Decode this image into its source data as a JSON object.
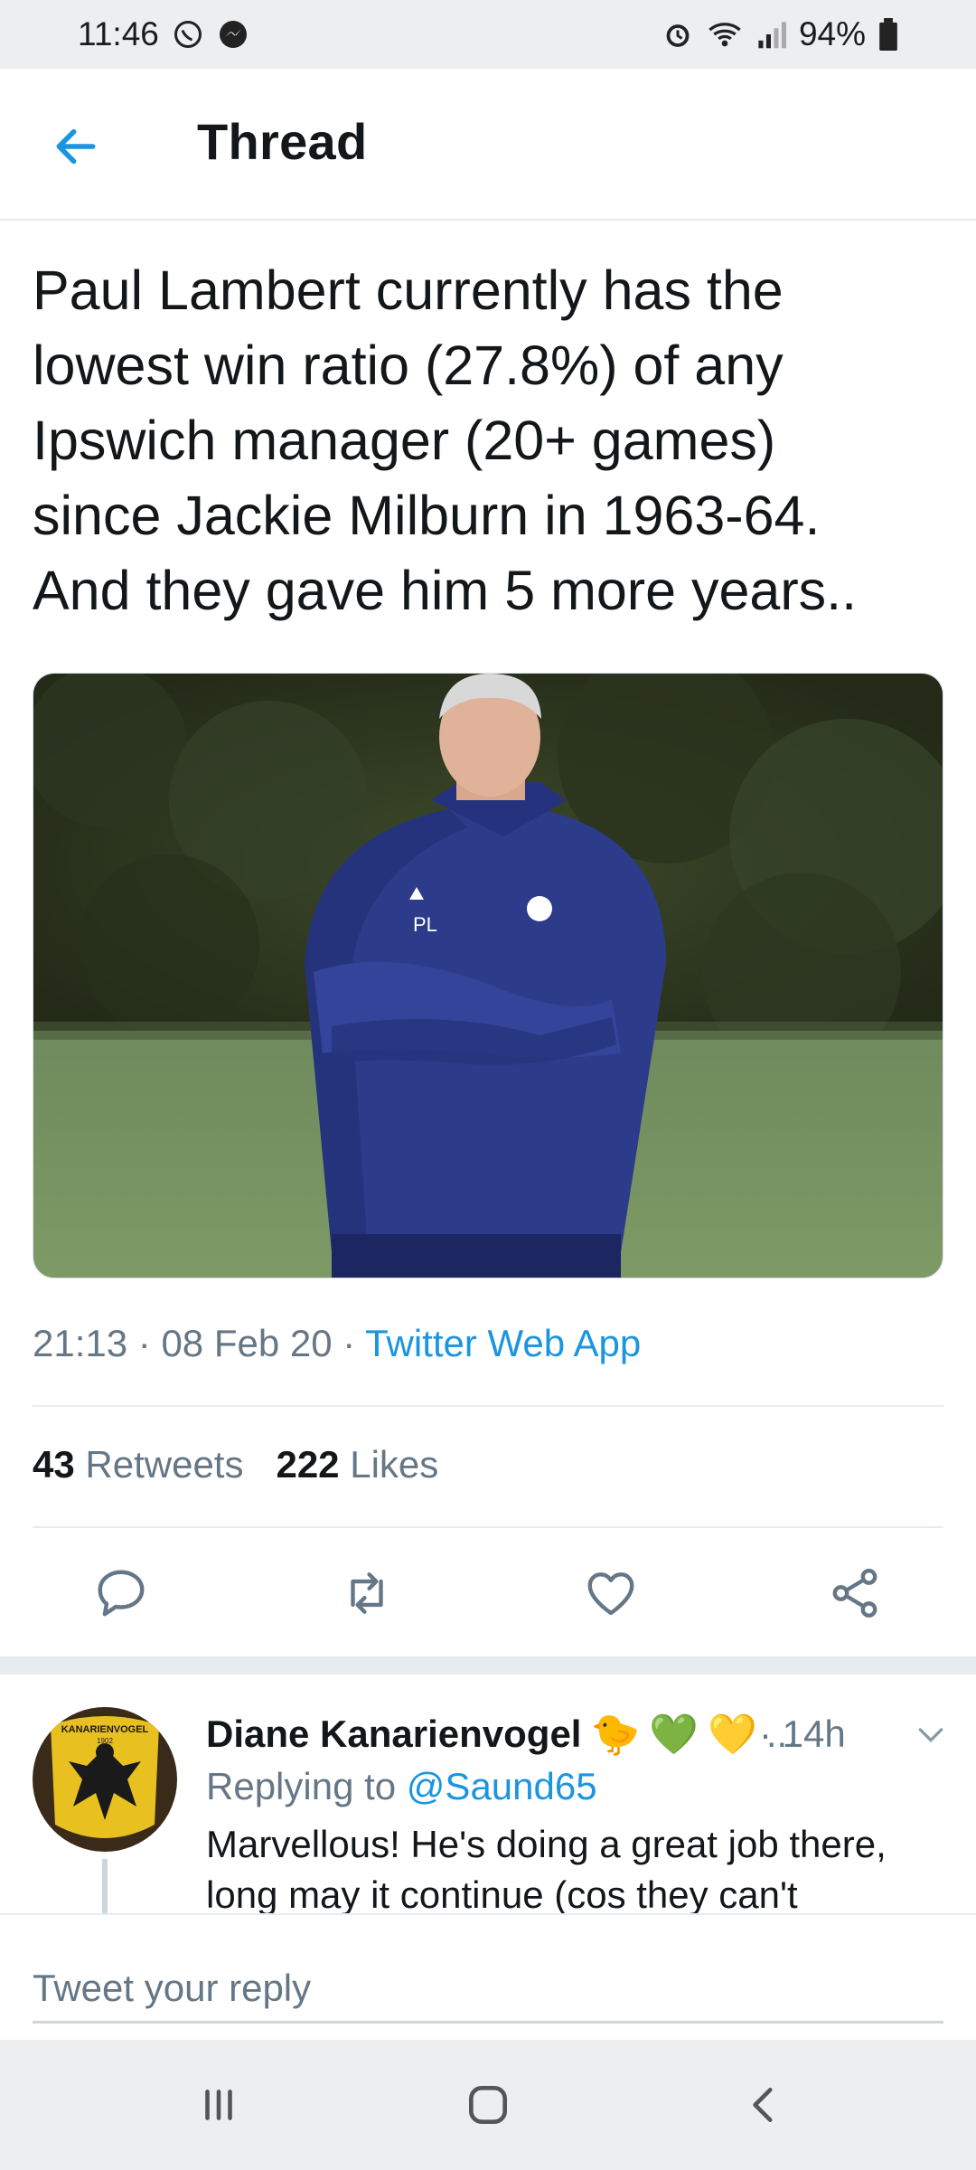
{
  "status_bar": {
    "time": "11:46",
    "battery": "94%"
  },
  "header": {
    "title": "Thread"
  },
  "tweet": {
    "lines": [
      "Paul Lambert currently has the",
      "lowest win ratio (27.8%) of any",
      "Ipswich manager (20+ games)",
      "since Jackie Milburn in 1963-64.",
      "And they gave him 5 more years.."
    ],
    "time": "21:13",
    "date": "08 Feb 20",
    "source": "Twitter Web App",
    "retweets_count": "43",
    "retweets_label": "Retweets",
    "likes_count": "222",
    "likes_label": "Likes",
    "jacket_initials": "PL"
  },
  "reply": {
    "name": "Diane Kanarienvogel",
    "emojis": [
      "🐤",
      "💚",
      "💛"
    ],
    "ellipsis": "...",
    "time": "· 14h",
    "replying_prefix": "Replying to",
    "replying_handle": "@Saund65",
    "text": "Marvellous! He's doing a great job there, long may it continue (cos they can't",
    "avatar_text": "KANARIENVOGEL",
    "avatar_year": "1902"
  },
  "composer": {
    "placeholder": "Tweet your reply"
  },
  "colors": {
    "accent": "#1b95e0",
    "secondary_text": "#657786",
    "divider": "#e6ecf0"
  }
}
